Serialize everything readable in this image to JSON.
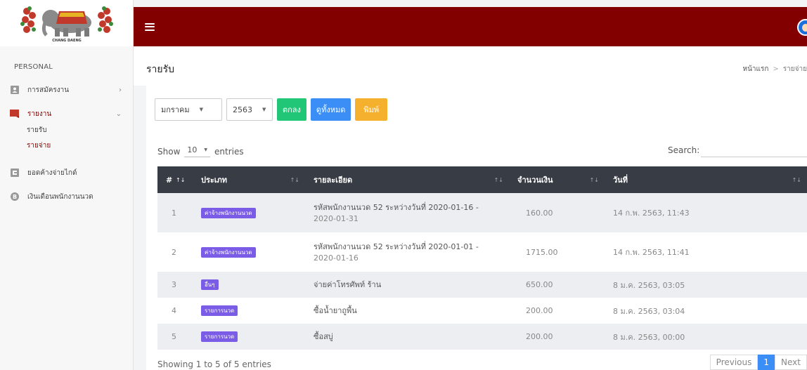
{
  "logo": {
    "text": "CHANG DAENG MASSAGE"
  },
  "sidebar": {
    "section": "PERSONAL",
    "items": [
      {
        "label": "การสมัครงาน",
        "icon": "user-card-icon",
        "arrow": "›"
      },
      {
        "label": "รายงาน",
        "icon": "report-icon",
        "arrow": "⌄"
      },
      {
        "label": "ยอดค้างจ่ายไกด์",
        "icon": "wallet-icon"
      },
      {
        "label": "เงินเดือนพนักงานนวด",
        "icon": "bitcoin-icon"
      }
    ],
    "subitems": [
      {
        "label": "รายรับ"
      },
      {
        "label": "รายจ่าย"
      }
    ]
  },
  "page": {
    "title": "รายรับ",
    "breadcrumb": {
      "home": "หน้าแรก",
      "sep": ">",
      "current": "รายจ่าย"
    }
  },
  "filters": {
    "month": "มกราคม",
    "year": "2563",
    "ok_label": "ตกลง",
    "view_all_label": "ดูทั้งหมด",
    "print_label": "พิมพ์"
  },
  "table_controls": {
    "show": "Show",
    "entries_value": "10",
    "entries": "entries",
    "search_label": "Search:"
  },
  "table": {
    "columns": [
      "#",
      "ประเภท",
      "รายละเอียด",
      "จำนวนเงิน",
      "วันที่"
    ],
    "rows": [
      {
        "num": "1",
        "type": "ค่าจ้างพนักงานนวด",
        "detail_1": "รหัสพนักงานนวด 52 ระหว่างวันที่ 2020-01-16 -",
        "detail_2": "2020-01-31",
        "amount": "160.00",
        "date": "14 ก.พ. 2563, 11:43"
      },
      {
        "num": "2",
        "type": "ค่าจ้างพนักงานนวด",
        "detail_1": "รหัสพนักงานนวด 52 ระหว่างวันที่ 2020-01-01 -",
        "detail_2": "2020-01-16",
        "amount": "1715.00",
        "date": "14 ก.พ. 2563, 11:41"
      },
      {
        "num": "3",
        "type": "อื่นๆ",
        "detail_1": "จ่ายค่าโทรศัพท์ ร้าน",
        "detail_2": "",
        "amount": "650.00",
        "date": "8 ม.ค. 2563, 03:05"
      },
      {
        "num": "4",
        "type": "รายการนวด",
        "detail_1": "ซื้อน้ำยาถูพื้น",
        "detail_2": "",
        "amount": "200.00",
        "date": "8 ม.ค. 2563, 03:04"
      },
      {
        "num": "5",
        "type": "รายการนวด",
        "detail_1": "ซื้อสบู่",
        "detail_2": "",
        "amount": "200.00",
        "date": "8 ม.ค. 2563, 00:00"
      }
    ]
  },
  "footer": {
    "info": "Showing 1 to 5 of 5 entries",
    "previous": "Previous",
    "page": "1",
    "next": "Next"
  },
  "colors": {
    "topbar": "#820000",
    "active_menu": "#8b0000",
    "badge": "#7b5ce6",
    "btn_ok": "#21c777",
    "btn_view_all": "#3a8ef6",
    "btn_print": "#f5b02e"
  }
}
